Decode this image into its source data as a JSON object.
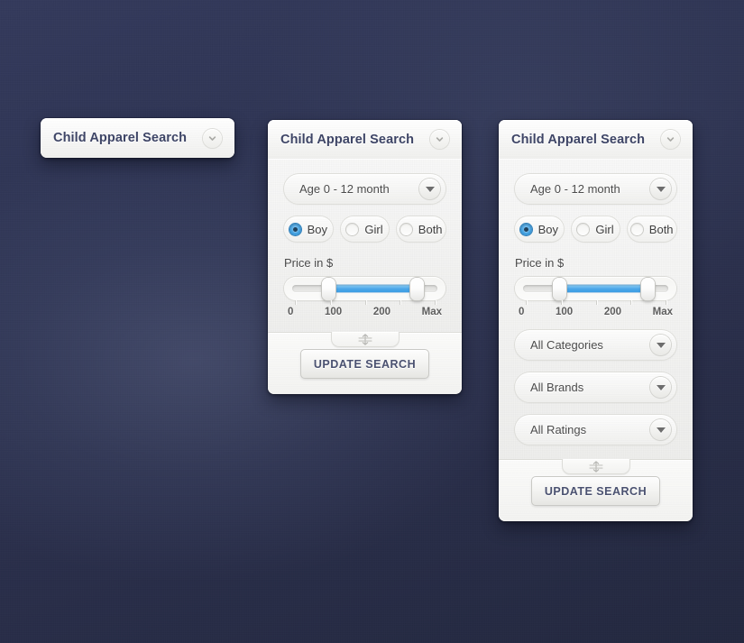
{
  "background": {
    "base_color": "#2b3050",
    "accent_color": "#4aa6e8"
  },
  "panels": [
    {
      "id": "collapsed",
      "title": "Child Apparel Search",
      "collapse_icon": "chevron-down-icon",
      "state": "collapsed"
    },
    {
      "id": "medium",
      "title": "Child Apparel Search",
      "collapse_icon": "chevron-down-icon",
      "state": "expanded",
      "age_select": {
        "value": "Age 0 - 12 month",
        "arrow_icon": "caret-down-icon"
      },
      "gender": {
        "options": [
          {
            "label": "Boy",
            "checked": true
          },
          {
            "label": "Girl",
            "checked": false
          },
          {
            "label": "Both",
            "checked": false
          }
        ]
      },
      "price": {
        "caption": "Price in $",
        "scale": [
          "0",
          "100",
          "200",
          "Max"
        ],
        "min_percent": 25,
        "max_percent": 86
      },
      "resize_grip_icon": "resize-vertical-icon",
      "update_button": "UPDATE SEARCH"
    },
    {
      "id": "tall",
      "title": "Child Apparel Search",
      "collapse_icon": "chevron-down-icon",
      "state": "expanded",
      "age_select": {
        "value": "Age 0 - 12 month",
        "arrow_icon": "caret-down-icon"
      },
      "gender": {
        "options": [
          {
            "label": "Boy",
            "checked": true
          },
          {
            "label": "Girl",
            "checked": false
          },
          {
            "label": "Both",
            "checked": false
          }
        ]
      },
      "price": {
        "caption": "Price in $",
        "scale": [
          "0",
          "100",
          "200",
          "Max"
        ],
        "min_percent": 25,
        "max_percent": 86
      },
      "filters": [
        {
          "value": "All Categories",
          "arrow_icon": "caret-down-icon"
        },
        {
          "value": "All Brands",
          "arrow_icon": "caret-down-icon"
        },
        {
          "value": "All Ratings",
          "arrow_icon": "caret-down-icon"
        }
      ],
      "resize_grip_icon": "resize-vertical-icon",
      "update_button": "UPDATE SEARCH"
    }
  ]
}
